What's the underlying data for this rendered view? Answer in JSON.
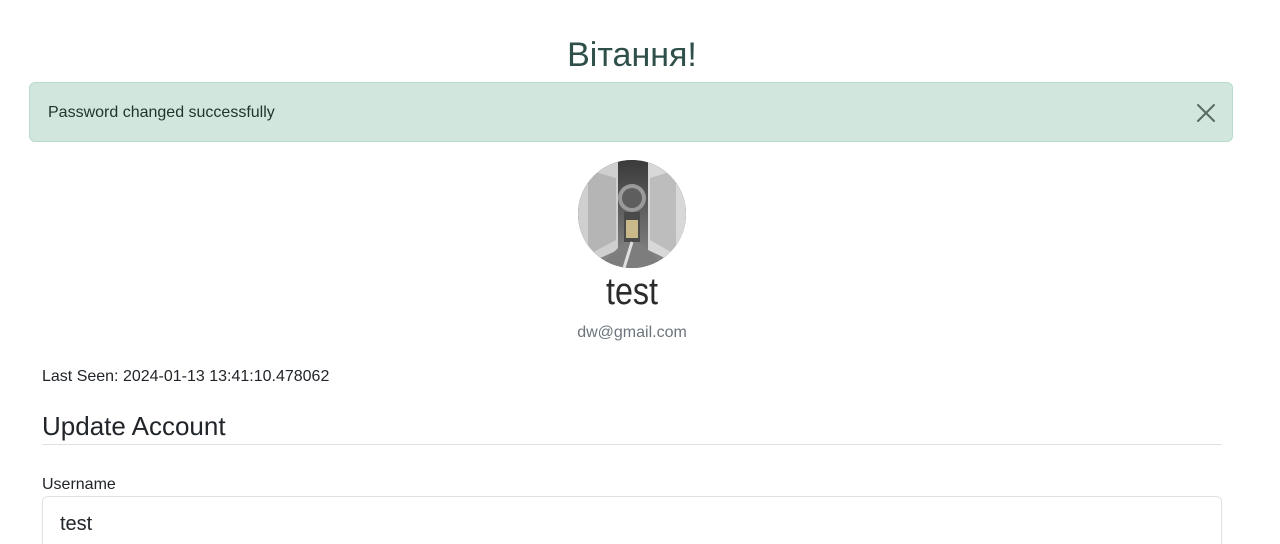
{
  "header": {
    "greeting": "Вітання!"
  },
  "alert": {
    "message": "Password changed successfully",
    "close_icon": "close-icon",
    "background": "#d1e7dd"
  },
  "profile": {
    "avatar_icon": "profile-photo",
    "username": "test",
    "email": "dw@gmail.com",
    "last_seen": "Last Seen: 2024-01-13 13:41:10.478062"
  },
  "update_account": {
    "title": "Update Account",
    "username_label": "Username",
    "username_value": "test"
  }
}
